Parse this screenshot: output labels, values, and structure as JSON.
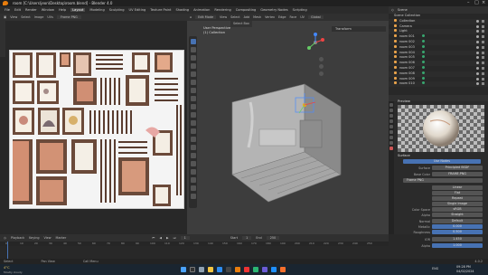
{
  "window": {
    "title": "room [C:\\Users\\jeon\\Desktop\\room.blend] - Blender 4.0"
  },
  "menus": [
    "File",
    "Edit",
    "Render",
    "Window",
    "Help",
    "Layout",
    "Modeling",
    "Sculpting",
    "UV Editing",
    "Texture Paint",
    "Shading",
    "Animation",
    "Rendering",
    "Compositing",
    "Geometry Nodes",
    "Scripting"
  ],
  "menu_active": "Layout",
  "image_editor": {
    "menus": [
      "View",
      "Select",
      "Image",
      "UVs"
    ],
    "image_name": "Frame PNG"
  },
  "viewport": {
    "mode": "Edit Mode",
    "menus": [
      "View",
      "Select",
      "Add",
      "Mesh",
      "Vertex",
      "Edge",
      "Face",
      "UV"
    ],
    "perspective": "User Perspective",
    "collection": "(1) Collection",
    "orientation": "Global",
    "transform_label": "Transform",
    "select_box": "Select Box"
  },
  "outliner": {
    "header": "Scene",
    "root": "Scene Collection",
    "items": [
      "Collection",
      "Camera",
      "Light",
      "room 001",
      "room 002",
      "room 003",
      "room 004",
      "room 005",
      "room 006",
      "room 007",
      "room 008",
      "room 009",
      "room 010"
    ]
  },
  "properties": {
    "preview_label": "Preview",
    "surface_label": "Surface",
    "use_nodes": "Use Nodes",
    "surface_field": "Principled BSDF",
    "base_color_label": "Base Color",
    "base_color_value": "FRAME.PNG",
    "image_name": "Frame PNG",
    "interp": "Linear",
    "projection": "Flat",
    "extension": "Repeat",
    "source": "Single Image",
    "color_space_label": "Color Space",
    "color_space": "sRGB",
    "alpha_label": "Alpha",
    "alpha_value": "Straight",
    "metallic_label": "Metallic",
    "metallic_value": "0.000",
    "roughness_label": "Roughness",
    "roughness_value": "0.500",
    "ior_label": "IOR",
    "ior_value": "1.450",
    "alpha2_label": "Alpha",
    "alpha2_value": "1.000",
    "normal_label": "Normal",
    "normal_value": "Default"
  },
  "timeline": {
    "menus": [
      "Playback",
      "Keying",
      "View",
      "Marker"
    ],
    "start_label": "Start",
    "start": "1",
    "end_label": "End",
    "end": "250",
    "frame": "1",
    "ticks": [
      "0",
      "10",
      "20",
      "30",
      "40",
      "50",
      "60",
      "70",
      "80",
      "90",
      "100",
      "110",
      "120",
      "130",
      "140",
      "150",
      "160",
      "170",
      "180",
      "190",
      "200",
      "210",
      "220",
      "230",
      "240",
      "250"
    ]
  },
  "status": {
    "left": "Select",
    "mid": "Pan View",
    "right": "Call Menu",
    "version": "4.0.2"
  },
  "taskbar": {
    "weather": "4°C",
    "weather_sub": "Mostly cloudy",
    "time": "09:28 PM",
    "date": "04/02/2024",
    "lang": "ENG"
  }
}
